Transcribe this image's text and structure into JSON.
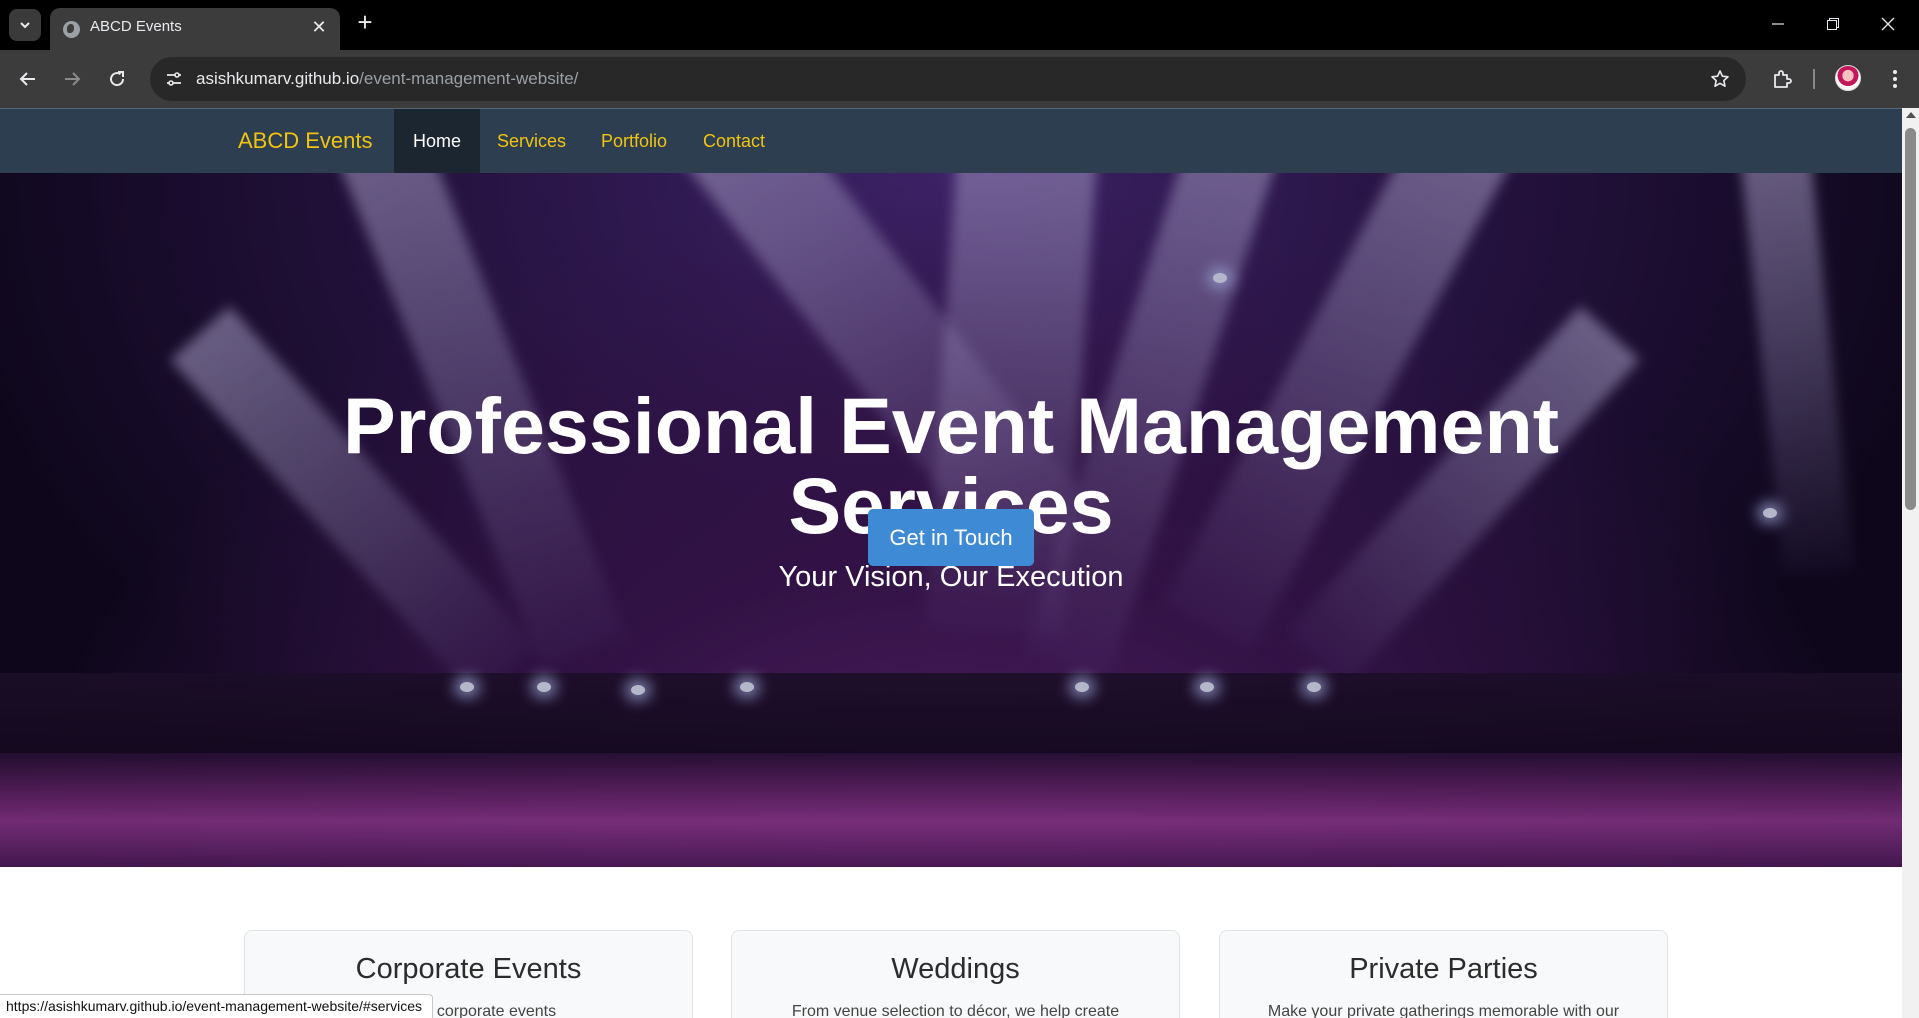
{
  "browser": {
    "tab_title": "ABCD Events",
    "url_host": "asishkumarv.github.io",
    "url_path": "/event-management-website/",
    "status_url": "https://asishkumarv.github.io/event-management-website/#services"
  },
  "site": {
    "brand": "ABCD Events",
    "nav": [
      {
        "label": "Home",
        "active": true
      },
      {
        "label": "Services",
        "active": false
      },
      {
        "label": "Portfolio",
        "active": false
      },
      {
        "label": "Contact",
        "active": false
      }
    ],
    "hero": {
      "title": "Professional Event Management Services",
      "subtitle": "Your Vision, Our Execution",
      "cta_label": "Get in Touch"
    },
    "services": [
      {
        "title": "Corporate Events",
        "text": "...cts of corporate events"
      },
      {
        "title": "Weddings",
        "text": "From venue selection to décor, we help create"
      },
      {
        "title": "Private Parties",
        "text": "Make your private gatherings memorable with our"
      }
    ]
  },
  "colors": {
    "nav_bg": "#2c3e50",
    "brand": "#f1c40f",
    "cta": "#3f8ad4"
  }
}
